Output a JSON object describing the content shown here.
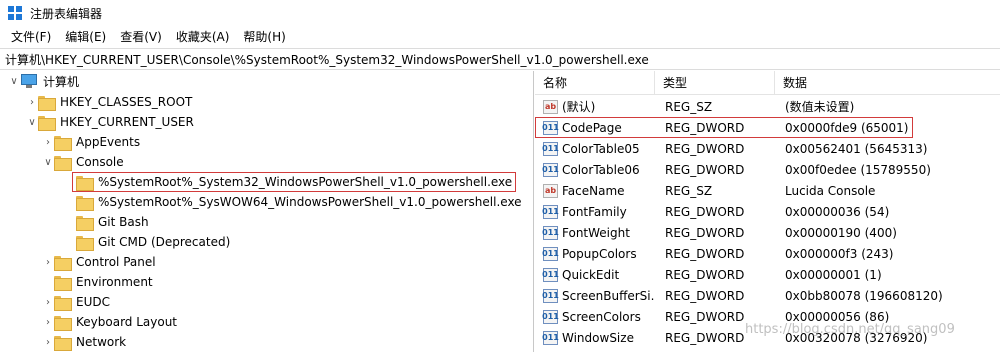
{
  "window": {
    "title": "注册表编辑器"
  },
  "menu": [
    "文件(F)",
    "编辑(E)",
    "查看(V)",
    "收藏夹(A)",
    "帮助(H)"
  ],
  "address": "计算机\\HKEY_CURRENT_USER\\Console\\%SystemRoot%_System32_WindowsPowerShell_v1.0_powershell.exe",
  "tree": {
    "root": "计算机",
    "items": [
      {
        "label": "HKEY_CLASSES_ROOT"
      },
      {
        "label": "HKEY_CURRENT_USER"
      },
      {
        "label": "AppEvents"
      },
      {
        "label": "Console"
      },
      {
        "label": "%SystemRoot%_System32_WindowsPowerShell_v1.0_powershell.exe"
      },
      {
        "label": "%SystemRoot%_SysWOW64_WindowsPowerShell_v1.0_powershell.exe"
      },
      {
        "label": "Git Bash"
      },
      {
        "label": "Git CMD (Deprecated)"
      },
      {
        "label": "Control Panel"
      },
      {
        "label": "Environment"
      },
      {
        "label": "EUDC"
      },
      {
        "label": "Keyboard Layout"
      },
      {
        "label": "Network"
      }
    ]
  },
  "list": {
    "columns": {
      "name": "名称",
      "type": "类型",
      "data": "数据"
    },
    "rows": [
      {
        "icon": "ab",
        "name": "(默认)",
        "type": "REG_SZ",
        "data": "(数值未设置)"
      },
      {
        "icon": "dw",
        "name": "CodePage",
        "type": "REG_DWORD",
        "data": "0x0000fde9 (65001)"
      },
      {
        "icon": "dw",
        "name": "ColorTable05",
        "type": "REG_DWORD",
        "data": "0x00562401 (5645313)"
      },
      {
        "icon": "dw",
        "name": "ColorTable06",
        "type": "REG_DWORD",
        "data": "0x00f0edee (15789550)"
      },
      {
        "icon": "ab",
        "name": "FaceName",
        "type": "REG_SZ",
        "data": "Lucida Console"
      },
      {
        "icon": "dw",
        "name": "FontFamily",
        "type": "REG_DWORD",
        "data": "0x00000036 (54)"
      },
      {
        "icon": "dw",
        "name": "FontWeight",
        "type": "REG_DWORD",
        "data": "0x00000190 (400)"
      },
      {
        "icon": "dw",
        "name": "PopupColors",
        "type": "REG_DWORD",
        "data": "0x000000f3 (243)"
      },
      {
        "icon": "dw",
        "name": "QuickEdit",
        "type": "REG_DWORD",
        "data": "0x00000001 (1)"
      },
      {
        "icon": "dw",
        "name": "ScreenBufferSi...",
        "type": "REG_DWORD",
        "data": "0x0bb80078 (196608120)"
      },
      {
        "icon": "dw",
        "name": "ScreenColors",
        "type": "REG_DWORD",
        "data": "0x00000056 (86)"
      },
      {
        "icon": "dw",
        "name": "WindowSize",
        "type": "REG_DWORD",
        "data": "0x00320078 (3276920)"
      }
    ]
  },
  "icon_labels": {
    "string": "ab",
    "dword": "011"
  },
  "watermark": "https://blog.csdn.net/qq_sang09"
}
